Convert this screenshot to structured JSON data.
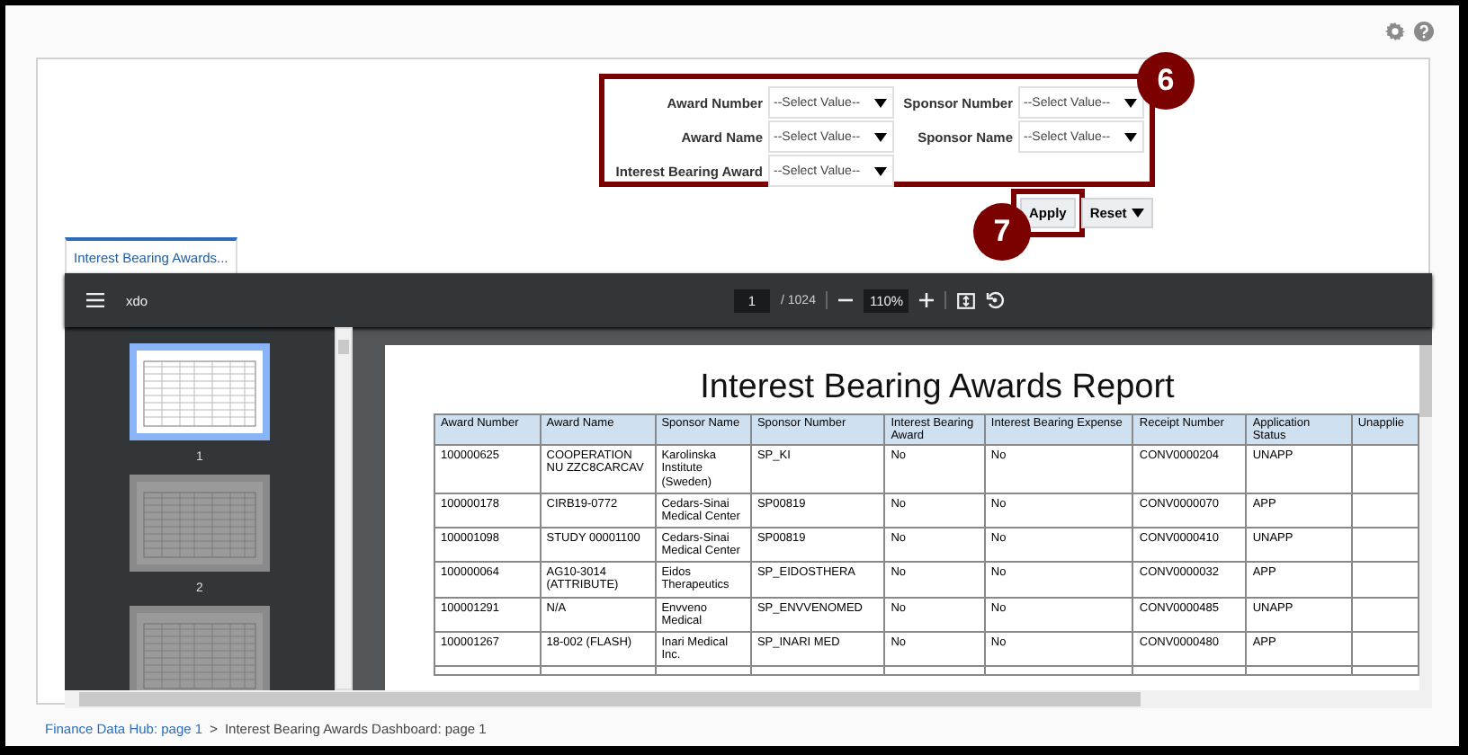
{
  "filters": [
    {
      "label": "Award Number",
      "placeholder": "--Select Value--"
    },
    {
      "label": "Sponsor Number",
      "placeholder": "--Select Value--"
    },
    {
      "label": "Award Name",
      "placeholder": "--Select Value--"
    },
    {
      "label": "Sponsor Name",
      "placeholder": "--Select Value--"
    },
    {
      "label": "Interest Bearing Award",
      "placeholder": "--Select Value--"
    }
  ],
  "callouts": [
    {
      "label": "6"
    },
    {
      "label": "7"
    }
  ],
  "buttons": [
    {
      "label": "Apply",
      "highlighted": true,
      "menu": false
    },
    {
      "label": "Reset",
      "highlighted": false,
      "menu": true
    }
  ],
  "tabs": [
    {
      "label": "Interest Bearing Awards...",
      "selected": true
    }
  ],
  "viewer": {
    "title": "xdo",
    "page": "1",
    "page_count": "/ 1024",
    "zoom": "110%",
    "thumbnails": [
      {
        "label": "1",
        "selected": true
      },
      {
        "label": "2",
        "selected": false
      },
      {
        "selected": false
      }
    ]
  },
  "report": {
    "title": "Interest Bearing Awards Report",
    "columns": [
      "Award Number",
      "Award Name",
      "Sponsor Name",
      "Sponsor Number",
      "Interest Bearing Award",
      "Interest Bearing Expense",
      "Receipt Number",
      "Application Status",
      "Unapplie"
    ],
    "rows": [
      [
        "100000625",
        "COOPERATION NU ZZC8CARCAV",
        "Karolinska Institute (Sweden)",
        "SP_KI",
        "No",
        "No",
        "CONV0000204",
        "UNAPP",
        ""
      ],
      [
        "100000178",
        "CIRB19-0772",
        "Cedars-Sinai Medical Center",
        "SP00819",
        "No",
        "No",
        "CONV0000070",
        "APP",
        ""
      ],
      [
        "100001098",
        "STUDY 00001100",
        "Cedars-Sinai Medical Center",
        "SP00819",
        "No",
        "No",
        "CONV0000410",
        "UNAPP",
        ""
      ],
      [
        "100000064",
        "AG10-3014 (ATTRIBUTE)",
        "Eidos Therapeutics",
        "SP_EIDOSTHERA",
        "No",
        "No",
        "CONV0000032",
        "APP",
        ""
      ],
      [
        "100001291",
        "N/A",
        "Envveno Medical",
        "SP_ENVVENOMED",
        "No",
        "No",
        "CONV0000485",
        "UNAPP",
        ""
      ],
      [
        "100001267",
        "18-002 (FLASH)",
        "Inari Medical Inc.",
        "SP_INARI MED",
        "No",
        "No",
        "CONV0000480",
        "APP",
        ""
      ]
    ]
  },
  "breadcrumb": [
    {
      "label": "Finance Data Hub: page 1",
      "link": true
    },
    {
      "label": ">",
      "link": false
    },
    {
      "label": "Interest Bearing Awards Dashboard: page 1",
      "link": false
    }
  ]
}
